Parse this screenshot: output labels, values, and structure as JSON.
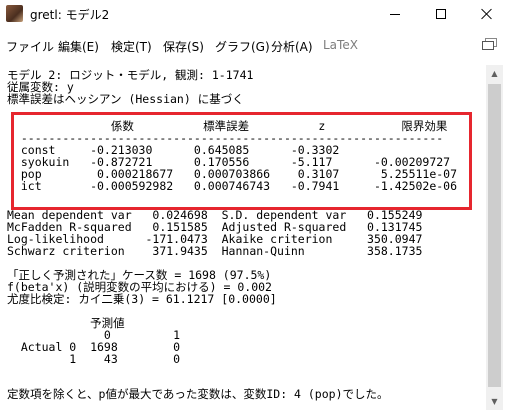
{
  "window": {
    "title": "gretl: モデル2",
    "minimize_label": "minimize",
    "maximize_label": "maximize",
    "close_label": "close"
  },
  "menu": {
    "items": [
      {
        "label": "ファイル"
      },
      {
        "label": "編集(E)"
      },
      {
        "label": "検定(T)"
      },
      {
        "label": "保存(S)"
      },
      {
        "label": "グラフ(G)"
      },
      {
        "label": "分析(A)"
      },
      {
        "label": "LaTeX"
      }
    ]
  },
  "output": {
    "lines": [
      "モデル 2: ロジット・モデル, 観測: 1-1741",
      "従属変数: y",
      "標準誤差はヘッシアン (Hessian) に基づく",
      "",
      "               係数          標準誤差          z           限界効果",
      "  -------------------------------------------------------------",
      "  const     -0.213030      0.645085      -0.3302",
      "  syokuin   -0.872721      0.170556      -5.117      -0.00209727",
      "  pop        0.000218677   0.000703866    0.3107      5.25511e-07",
      "  ict       -0.000592982   0.000746743   -0.7941     -1.42502e-06",
      "",
      "Mean dependent var   0.024698  S.D. dependent var   0.155249",
      "McFadden R-squared   0.151585  Adjusted R-squared   0.131745",
      "Log-likelihood      -171.0473  Akaike criterion     350.0947",
      "Schwarz criterion    371.9435  Hannan-Quinn         358.1735",
      "",
      "「正しく予測された」ケース数 = 1698 (97.5%)",
      "f(beta'x) (説明変数の平均における) = 0.002",
      "尤度比検定: カイ二乗(3) = 61.1217 [0.0000]",
      "",
      "            予測値",
      "              0         1",
      "  Actual 0  1698        0",
      "         1    43        0",
      "",
      "定数項を除くと、p値が最大であった変数は、変数ID: 4 (pop)でした。"
    ]
  },
  "scrollbar": {
    "up_arrow": "▲",
    "down_arrow": "▼"
  }
}
